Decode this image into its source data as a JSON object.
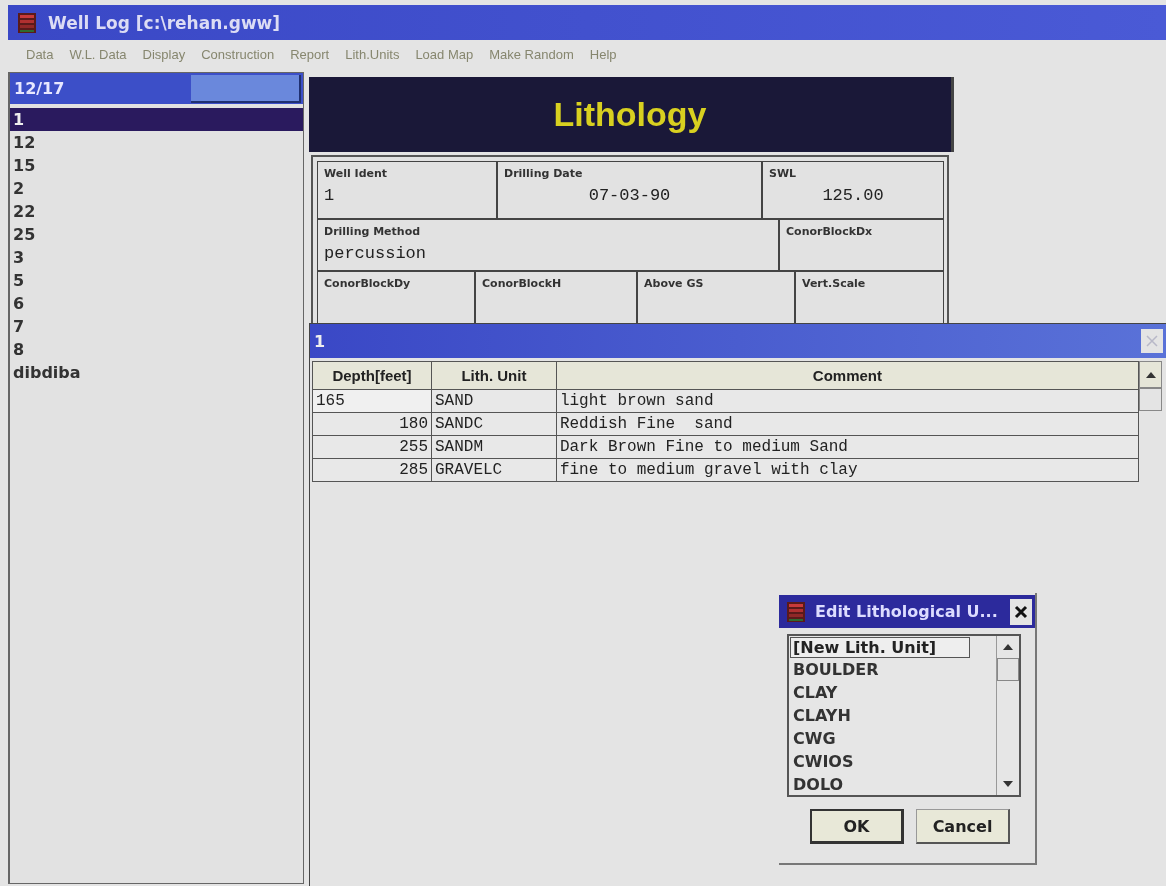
{
  "window": {
    "title": "Well Log [c:\\rehan.gww]"
  },
  "menu": [
    {
      "label": "Data",
      "disabled": true
    },
    {
      "label": "W.L. Data",
      "disabled": true
    },
    {
      "label": "Display",
      "disabled": true
    },
    {
      "label": "Construction",
      "disabled": true
    },
    {
      "label": "Report",
      "disabled": true
    },
    {
      "label": "Lith.Units",
      "disabled": true
    },
    {
      "label": "Load Map",
      "disabled": true
    },
    {
      "label": "Make Random",
      "disabled": true
    },
    {
      "label": "Help",
      "disabled": true
    }
  ],
  "well_list": {
    "header": "12/17",
    "items": [
      {
        "label": "1",
        "selected": true
      },
      {
        "label": "12",
        "selected": false
      },
      {
        "label": "15",
        "selected": false
      },
      {
        "label": "2",
        "selected": false
      },
      {
        "label": "22",
        "selected": false
      },
      {
        "label": "25",
        "selected": false
      },
      {
        "label": "3",
        "selected": false
      },
      {
        "label": "5",
        "selected": false
      },
      {
        "label": "6",
        "selected": false
      },
      {
        "label": "7",
        "selected": false
      },
      {
        "label": "8",
        "selected": false
      },
      {
        "label": "dibdiba",
        "selected": false
      }
    ]
  },
  "banner": {
    "title": "Lithology"
  },
  "well_form": {
    "fields": [
      {
        "label": "Well Ident",
        "value": "1"
      },
      {
        "label": "Drilling Date",
        "value": "07-03-90"
      },
      {
        "label": "SWL",
        "value": "125.00"
      },
      {
        "label": "Drilling Method",
        "value": "percussion"
      },
      {
        "label": "ConorBlockDx"
      },
      {
        "label": "ConorBlockDy"
      },
      {
        "label": "ConorBlockH"
      },
      {
        "label": "Above GS"
      },
      {
        "label": "Vert.Scale"
      }
    ]
  },
  "child_window": {
    "title": "1",
    "table": {
      "columns": [
        "Depth[feet]",
        "Lith. Unit",
        "Comment"
      ],
      "rows": [
        {
          "cells": [
            "165",
            "SAND",
            "light brown sand"
          ],
          "editing": true
        },
        {
          "cells": [
            "180",
            "SANDC",
            "Reddish Fine  sand"
          ],
          "editing": false
        },
        {
          "cells": [
            "255",
            "SANDM",
            "Dark Brown Fine to medium Sand"
          ],
          "editing": false
        },
        {
          "cells": [
            "285",
            "GRAVELC",
            "fine to medium gravel with clay"
          ],
          "editing": false
        }
      ]
    }
  },
  "dialog": {
    "title": "Edit Lithological U...",
    "input": {
      "value": "[New Lith. Unit]"
    },
    "items": [
      "BOULDER",
      "CLAY",
      "CLAYH",
      "CWG",
      "CWIOS",
      "DOLO"
    ],
    "buttons": [
      "OK",
      "Cancel"
    ]
  }
}
